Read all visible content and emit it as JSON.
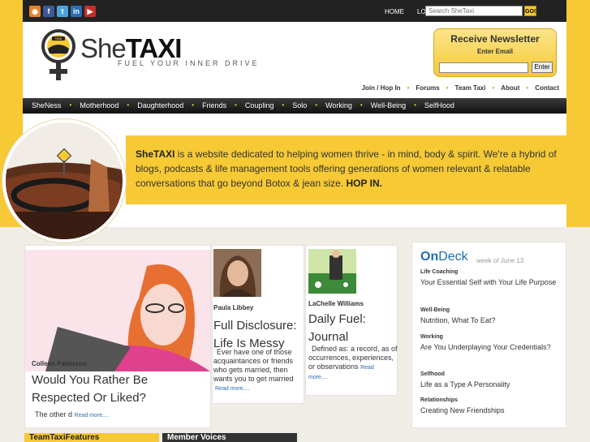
{
  "top": {
    "nav": [
      "HOME",
      "LOGIN"
    ],
    "search_placeholder": "Search SheTaxi",
    "go_label": "GO!"
  },
  "social": [
    {
      "icon": "rss-icon",
      "glyph": "◉",
      "color": "#e4832d"
    },
    {
      "icon": "facebook-icon",
      "glyph": "f",
      "color": "#3b5998"
    },
    {
      "icon": "twitter-icon",
      "glyph": "t",
      "color": "#4aa3df"
    },
    {
      "icon": "linkedin-icon",
      "glyph": "in",
      "color": "#2a6db5"
    },
    {
      "icon": "youtube-icon",
      "glyph": "▶",
      "color": "#c4302b"
    }
  ],
  "brand": {
    "she": "She",
    "taxi": "TAXI",
    "tagline": "FUEL YOUR INNER DRIVE"
  },
  "newsletter": {
    "title": "Receive Newsletter",
    "subtitle": "Enter Email",
    "button": "Enter"
  },
  "subnav": [
    "Join / Hop In",
    "Forums",
    "Team Taxi",
    "About",
    "Contact"
  ],
  "categories": [
    "SheNess",
    "Motherhood",
    "Daughterhood",
    "Friends",
    "Coupling",
    "Solo",
    "Working",
    "Well-Being",
    "SelfHood"
  ],
  "hero": {
    "brand": "SheTAXI",
    "text": " is a website dedicated to helping women thrive - in mind, body & spirit. We're a hybrid of blogs, podcasts & life management tools offering generations of women relevant & relatable conversations that go beyond Botox & jean size. ",
    "cta": "HOP IN."
  },
  "posts": [
    {
      "author": "Colleen Patterson",
      "title": "Would You Rather Be Respected Or Liked?",
      "excerpt": "The other d",
      "more": "Read more...."
    },
    {
      "author": "Paula Libbey",
      "title": "Full Disclosure: Life Is Messy",
      "excerpt": "Ever have one of those acquaintances or friends who gets married, then wants you to get married",
      "more": "Read more...."
    },
    {
      "author": "LaChelle Williams",
      "title": "Daily Fuel: Journal",
      "excerpt": "Defined as:  a record, as of occurrences, experiences, or observations",
      "more_a": "Read",
      "more_b": "more...."
    }
  ],
  "ondeck": {
    "title_a": "On",
    "title_b": "Deck",
    "week": "week of June 13",
    "items": [
      {
        "category": "Life Coaching",
        "title": "Your Essential Self with Your Life Purpose"
      },
      {
        "category": "Well-Being",
        "title": "Nutrition, What To Eat?"
      },
      {
        "category": "Working",
        "title": "Are You Underplaying Your Credentials?"
      },
      {
        "category": "Selfhood",
        "title": "Life as a Type A Personality"
      },
      {
        "category": "Relationships",
        "title": "Creating New Friendships"
      }
    ]
  },
  "tabs": [
    "TeamTaxiFeatures",
    "Member Voices"
  ],
  "colors": {
    "accent": "#f6c935",
    "link": "#2a6db5",
    "dark": "#222222"
  }
}
